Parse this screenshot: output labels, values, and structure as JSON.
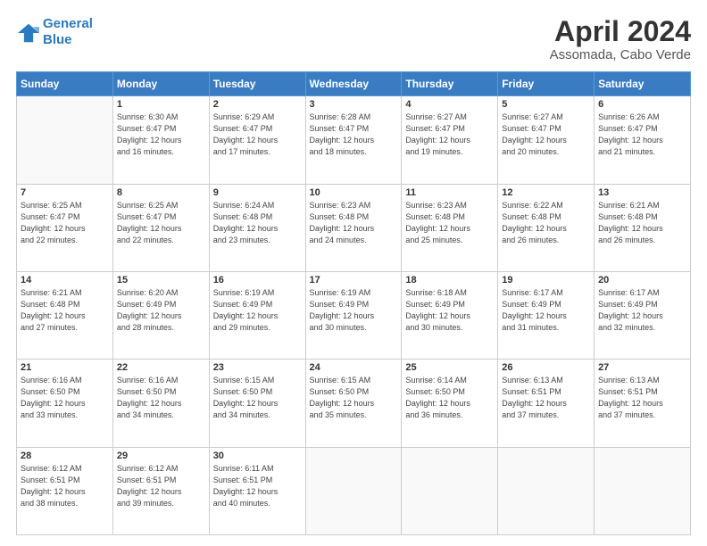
{
  "header": {
    "logo_line1": "General",
    "logo_line2": "Blue",
    "title": "April 2024",
    "subtitle": "Assomada, Cabo Verde"
  },
  "days_of_week": [
    "Sunday",
    "Monday",
    "Tuesday",
    "Wednesday",
    "Thursday",
    "Friday",
    "Saturday"
  ],
  "weeks": [
    [
      {
        "day": "",
        "info": ""
      },
      {
        "day": "1",
        "info": "Sunrise: 6:30 AM\nSunset: 6:47 PM\nDaylight: 12 hours\nand 16 minutes."
      },
      {
        "day": "2",
        "info": "Sunrise: 6:29 AM\nSunset: 6:47 PM\nDaylight: 12 hours\nand 17 minutes."
      },
      {
        "day": "3",
        "info": "Sunrise: 6:28 AM\nSunset: 6:47 PM\nDaylight: 12 hours\nand 18 minutes."
      },
      {
        "day": "4",
        "info": "Sunrise: 6:27 AM\nSunset: 6:47 PM\nDaylight: 12 hours\nand 19 minutes."
      },
      {
        "day": "5",
        "info": "Sunrise: 6:27 AM\nSunset: 6:47 PM\nDaylight: 12 hours\nand 20 minutes."
      },
      {
        "day": "6",
        "info": "Sunrise: 6:26 AM\nSunset: 6:47 PM\nDaylight: 12 hours\nand 21 minutes."
      }
    ],
    [
      {
        "day": "7",
        "info": "Sunrise: 6:25 AM\nSunset: 6:47 PM\nDaylight: 12 hours\nand 22 minutes."
      },
      {
        "day": "8",
        "info": "Sunrise: 6:25 AM\nSunset: 6:47 PM\nDaylight: 12 hours\nand 22 minutes."
      },
      {
        "day": "9",
        "info": "Sunrise: 6:24 AM\nSunset: 6:48 PM\nDaylight: 12 hours\nand 23 minutes."
      },
      {
        "day": "10",
        "info": "Sunrise: 6:23 AM\nSunset: 6:48 PM\nDaylight: 12 hours\nand 24 minutes."
      },
      {
        "day": "11",
        "info": "Sunrise: 6:23 AM\nSunset: 6:48 PM\nDaylight: 12 hours\nand 25 minutes."
      },
      {
        "day": "12",
        "info": "Sunrise: 6:22 AM\nSunset: 6:48 PM\nDaylight: 12 hours\nand 26 minutes."
      },
      {
        "day": "13",
        "info": "Sunrise: 6:21 AM\nSunset: 6:48 PM\nDaylight: 12 hours\nand 26 minutes."
      }
    ],
    [
      {
        "day": "14",
        "info": "Sunrise: 6:21 AM\nSunset: 6:48 PM\nDaylight: 12 hours\nand 27 minutes."
      },
      {
        "day": "15",
        "info": "Sunrise: 6:20 AM\nSunset: 6:49 PM\nDaylight: 12 hours\nand 28 minutes."
      },
      {
        "day": "16",
        "info": "Sunrise: 6:19 AM\nSunset: 6:49 PM\nDaylight: 12 hours\nand 29 minutes."
      },
      {
        "day": "17",
        "info": "Sunrise: 6:19 AM\nSunset: 6:49 PM\nDaylight: 12 hours\nand 30 minutes."
      },
      {
        "day": "18",
        "info": "Sunrise: 6:18 AM\nSunset: 6:49 PM\nDaylight: 12 hours\nand 30 minutes."
      },
      {
        "day": "19",
        "info": "Sunrise: 6:17 AM\nSunset: 6:49 PM\nDaylight: 12 hours\nand 31 minutes."
      },
      {
        "day": "20",
        "info": "Sunrise: 6:17 AM\nSunset: 6:49 PM\nDaylight: 12 hours\nand 32 minutes."
      }
    ],
    [
      {
        "day": "21",
        "info": "Sunrise: 6:16 AM\nSunset: 6:50 PM\nDaylight: 12 hours\nand 33 minutes."
      },
      {
        "day": "22",
        "info": "Sunrise: 6:16 AM\nSunset: 6:50 PM\nDaylight: 12 hours\nand 34 minutes."
      },
      {
        "day": "23",
        "info": "Sunrise: 6:15 AM\nSunset: 6:50 PM\nDaylight: 12 hours\nand 34 minutes."
      },
      {
        "day": "24",
        "info": "Sunrise: 6:15 AM\nSunset: 6:50 PM\nDaylight: 12 hours\nand 35 minutes."
      },
      {
        "day": "25",
        "info": "Sunrise: 6:14 AM\nSunset: 6:50 PM\nDaylight: 12 hours\nand 36 minutes."
      },
      {
        "day": "26",
        "info": "Sunrise: 6:13 AM\nSunset: 6:51 PM\nDaylight: 12 hours\nand 37 minutes."
      },
      {
        "day": "27",
        "info": "Sunrise: 6:13 AM\nSunset: 6:51 PM\nDaylight: 12 hours\nand 37 minutes."
      }
    ],
    [
      {
        "day": "28",
        "info": "Sunrise: 6:12 AM\nSunset: 6:51 PM\nDaylight: 12 hours\nand 38 minutes."
      },
      {
        "day": "29",
        "info": "Sunrise: 6:12 AM\nSunset: 6:51 PM\nDaylight: 12 hours\nand 39 minutes."
      },
      {
        "day": "30",
        "info": "Sunrise: 6:11 AM\nSunset: 6:51 PM\nDaylight: 12 hours\nand 40 minutes."
      },
      {
        "day": "",
        "info": ""
      },
      {
        "day": "",
        "info": ""
      },
      {
        "day": "",
        "info": ""
      },
      {
        "day": "",
        "info": ""
      }
    ]
  ]
}
